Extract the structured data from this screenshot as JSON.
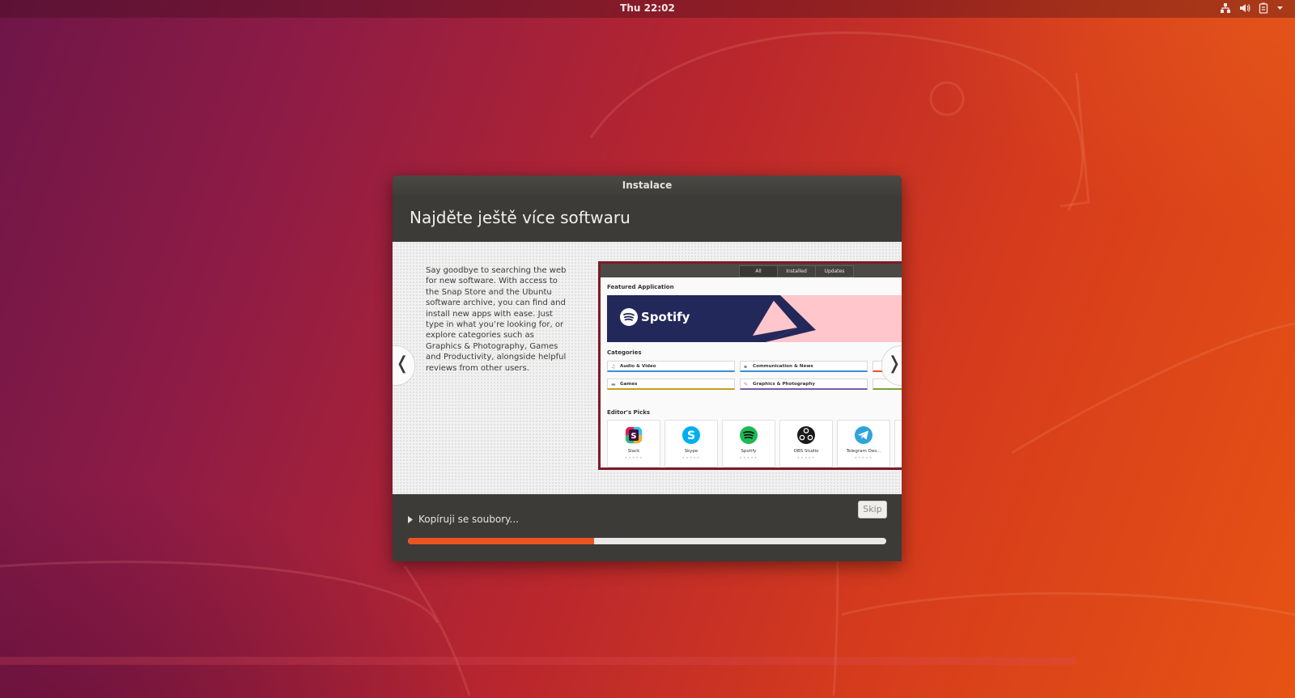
{
  "topbar": {
    "clock": "Thu 22:02",
    "icons": [
      "network-icon",
      "volume-icon",
      "battery-icon",
      "menu-arrow-icon"
    ]
  },
  "dialog": {
    "title": "Instalace",
    "heading": "Najděte ještě více softwaru",
    "slide": {
      "text": "Say goodbye to searching the web for new software. With access to the Snap Store and the Ubuntu software archive, you can find and install new apps with ease. Just type in what you’re looking for, or explore categories such as Graphics & Photography, Games and Productivity, alongside helpful reviews from other users.",
      "prev_symbol": "❬",
      "next_symbol": "❭",
      "store": {
        "tabs": [
          "All",
          "Installed",
          "Updates"
        ],
        "featured_label": "Featured Application",
        "featured_app": "Spotify",
        "categories_label": "Categories",
        "categories": [
          "Audio & Video",
          "Communication & News",
          "Games",
          "Graphics & Photography"
        ],
        "editors_label": "Editor's Picks",
        "picks": [
          "Slack",
          "Skype",
          "Spotify",
          "OBS Studio",
          "Telegram Des..."
        ]
      }
    },
    "status_text": "Kopíruji se soubory...",
    "skip_label": "Skip",
    "progress_fraction": 0.39
  },
  "colors": {
    "accent": "#e95420",
    "dialog_bg": "#3c3b37",
    "spotify_green": "#1db954"
  }
}
